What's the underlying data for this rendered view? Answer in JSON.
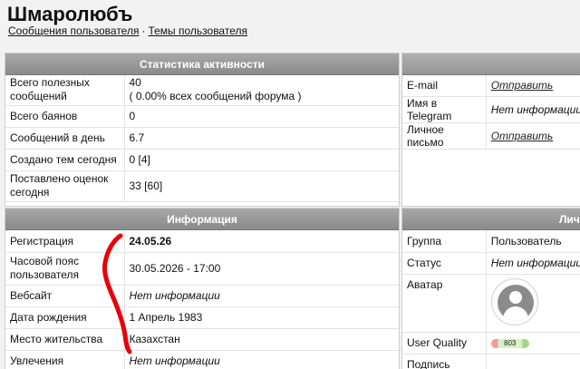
{
  "header": {
    "username": "Шмаролюбъ",
    "links": [
      "Сообщения пользователя",
      "Темы пользователя"
    ],
    "separator": "·"
  },
  "stats": {
    "title": "Статистика активности",
    "rows": [
      {
        "label": "Всего полезных сообщений",
        "value": "40",
        "note": "( 0.00% всех сообщений форума )"
      },
      {
        "label": "Всего баянов",
        "value": "0"
      },
      {
        "label": "Сообщений в день",
        "value": "6.7"
      },
      {
        "label": "Создано тем сегодня",
        "value": "0 [4]"
      },
      {
        "label": "Поставлено оценок сегодня",
        "value": "33 [60]"
      }
    ]
  },
  "contacts": {
    "rows": [
      {
        "label": "E-mail",
        "value": "Отправить"
      },
      {
        "label": "Имя в Telegram",
        "value": "Нет информации"
      },
      {
        "label": "Личное письмо",
        "value": "Отправить"
      }
    ]
  },
  "info": {
    "title": "Информация",
    "rows": [
      {
        "label": "Регистрация",
        "value": "24.05.26"
      },
      {
        "label": "Часовой пояс пользователя",
        "value": "30.05.2026 - 17:00"
      },
      {
        "label": "Вебсайт",
        "value": "Нет информации"
      },
      {
        "label": "Дата рождения",
        "value": "1 Апрель 1983"
      },
      {
        "label": "Место жительства",
        "value": "Казахстан"
      },
      {
        "label": "Увлечения",
        "value": "Нет информации"
      }
    ]
  },
  "personal": {
    "title": "Личная информация",
    "rows": [
      {
        "label": "Группа",
        "value": "Пользователь"
      },
      {
        "label": "Статус",
        "value": "Нет информации"
      },
      {
        "label": "Аватар",
        "value": ""
      },
      {
        "label": "User Quality",
        "value": "803"
      },
      {
        "label": "Подпись",
        "value": ""
      }
    ]
  },
  "colors": {
    "scribble": "#e8000a",
    "header_gradient_top": "#a8a8a8",
    "header_gradient_bottom": "#8a8a8a"
  }
}
